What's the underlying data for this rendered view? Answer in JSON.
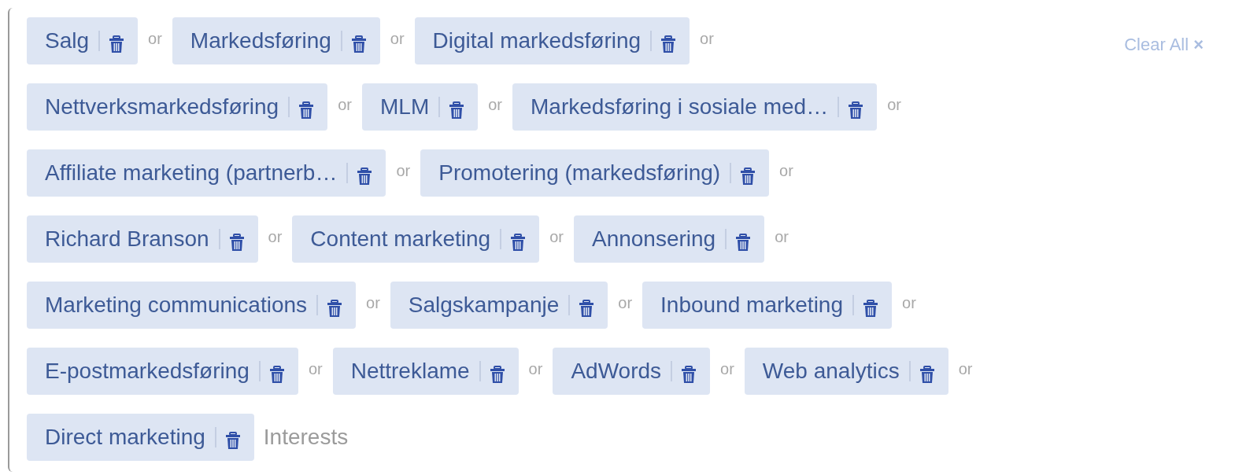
{
  "clear_all": {
    "label": "Clear All",
    "icon": "×"
  },
  "rows": [
    {
      "tokens": [
        {
          "label": "Salg",
          "separator": "or"
        },
        {
          "label": "Markedsføring",
          "separator": "or"
        },
        {
          "label": "Digital markedsføring",
          "separator": "or"
        }
      ]
    },
    {
      "tokens": [
        {
          "label": "Nettverksmarkedsføring",
          "separator": "or"
        },
        {
          "label": "MLM",
          "separator": "or"
        },
        {
          "label": "Markedsføring i sosiale med…",
          "separator": "or"
        }
      ]
    },
    {
      "tokens": [
        {
          "label": "Affiliate marketing (partnerb…",
          "separator": "or"
        },
        {
          "label": "Promotering (markedsføring)",
          "separator": "or"
        }
      ]
    },
    {
      "tokens": [
        {
          "label": "Richard Branson",
          "separator": "or"
        },
        {
          "label": "Content marketing",
          "separator": "or"
        },
        {
          "label": "Annonsering",
          "separator": "or"
        }
      ]
    },
    {
      "tokens": [
        {
          "label": "Marketing communications",
          "separator": "or"
        },
        {
          "label": "Salgskampanje",
          "separator": "or"
        },
        {
          "label": "Inbound marketing",
          "separator": "or"
        }
      ]
    },
    {
      "tokens": [
        {
          "label": "E-postmarkedsføring",
          "separator": "or"
        },
        {
          "label": "Nettreklame",
          "separator": "or"
        },
        {
          "label": "AdWords",
          "separator": "or"
        },
        {
          "label": "Web analytics",
          "separator": "or"
        }
      ]
    },
    {
      "tokens": [
        {
          "label": "Direct marketing"
        }
      ]
    }
  ],
  "input": {
    "placeholder": "Interests"
  }
}
